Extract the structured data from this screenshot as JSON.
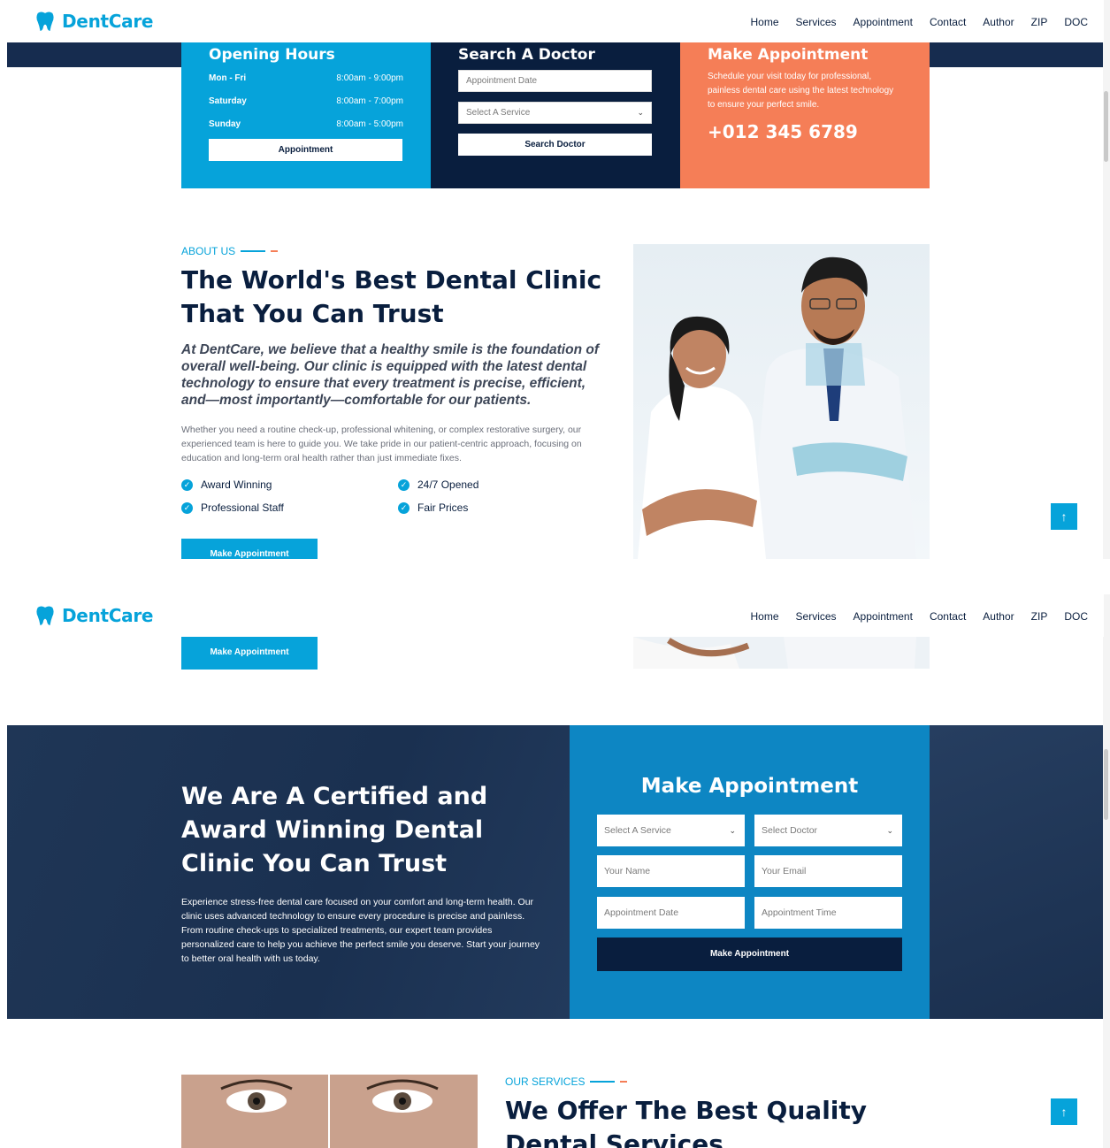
{
  "brand": {
    "name": "DentCare"
  },
  "nav": [
    "Home",
    "Services",
    "Appointment",
    "Contact",
    "Author",
    "ZIP",
    "DOC"
  ],
  "opening_hours": {
    "title": "Opening Hours",
    "rows": [
      {
        "day": "Mon - Fri",
        "time": "8:00am - 9:00pm"
      },
      {
        "day": "Saturday",
        "time": "8:00am - 7:00pm"
      },
      {
        "day": "Sunday",
        "time": "8:00am - 5:00pm"
      }
    ],
    "button": "Appointment"
  },
  "search_doctor": {
    "title": "Search A Doctor",
    "date_placeholder": "Appointment Date",
    "service_select": "Select A Service",
    "button": "Search Doctor"
  },
  "make_appointment_box": {
    "title": "Make Appointment",
    "text": "Schedule your visit today for professional, painless dental care using the latest technology to ensure your perfect smile.",
    "phone": "+012 345 6789"
  },
  "about": {
    "tag": "ABOUT US",
    "title": "The World's Best Dental Clinic That You Can Trust",
    "lead": "At DentCare, we believe that a healthy smile is the foundation of overall well-being. Our clinic is equipped with the latest dental technology to ensure that every treatment is precise, efficient, and—most importantly—comfortable for our patients.",
    "body": "Whether you need a routine check-up, professional whitening, or complex restorative surgery, our experienced team is here to guide you. We take pride in our patient-centric approach, focusing on education and long-term oral health rather than just immediate fixes.",
    "features": [
      "Award Winning",
      "24/7 Opened",
      "Professional Staff",
      "Fair Prices"
    ],
    "button": "Make Appointment"
  },
  "certified": {
    "title": "We Are A Certified and Award Winning Dental Clinic You Can Trust",
    "body": "Experience stress-free dental care focused on your comfort and long-term health. Our clinic uses advanced technology to ensure every procedure is precise and painless. From routine check-ups to specialized treatments, our expert team provides personalized care to help you achieve the perfect smile you deserve. Start your journey to better oral health with us today."
  },
  "appointment_form": {
    "title": "Make Appointment",
    "service_select": "Select A Service",
    "doctor_select": "Select Doctor",
    "name_placeholder": "Your Name",
    "email_placeholder": "Your Email",
    "date_placeholder": "Appointment Date",
    "time_placeholder": "Appointment Time",
    "button": "Make Appointment"
  },
  "services": {
    "tag": "OUR SERVICES",
    "title": "We Offer The Best Quality Dental Services"
  },
  "back_to_top": "↑",
  "colors": {
    "primary": "#06a3da",
    "dark": "#091e3e",
    "accent": "#f57e57"
  }
}
